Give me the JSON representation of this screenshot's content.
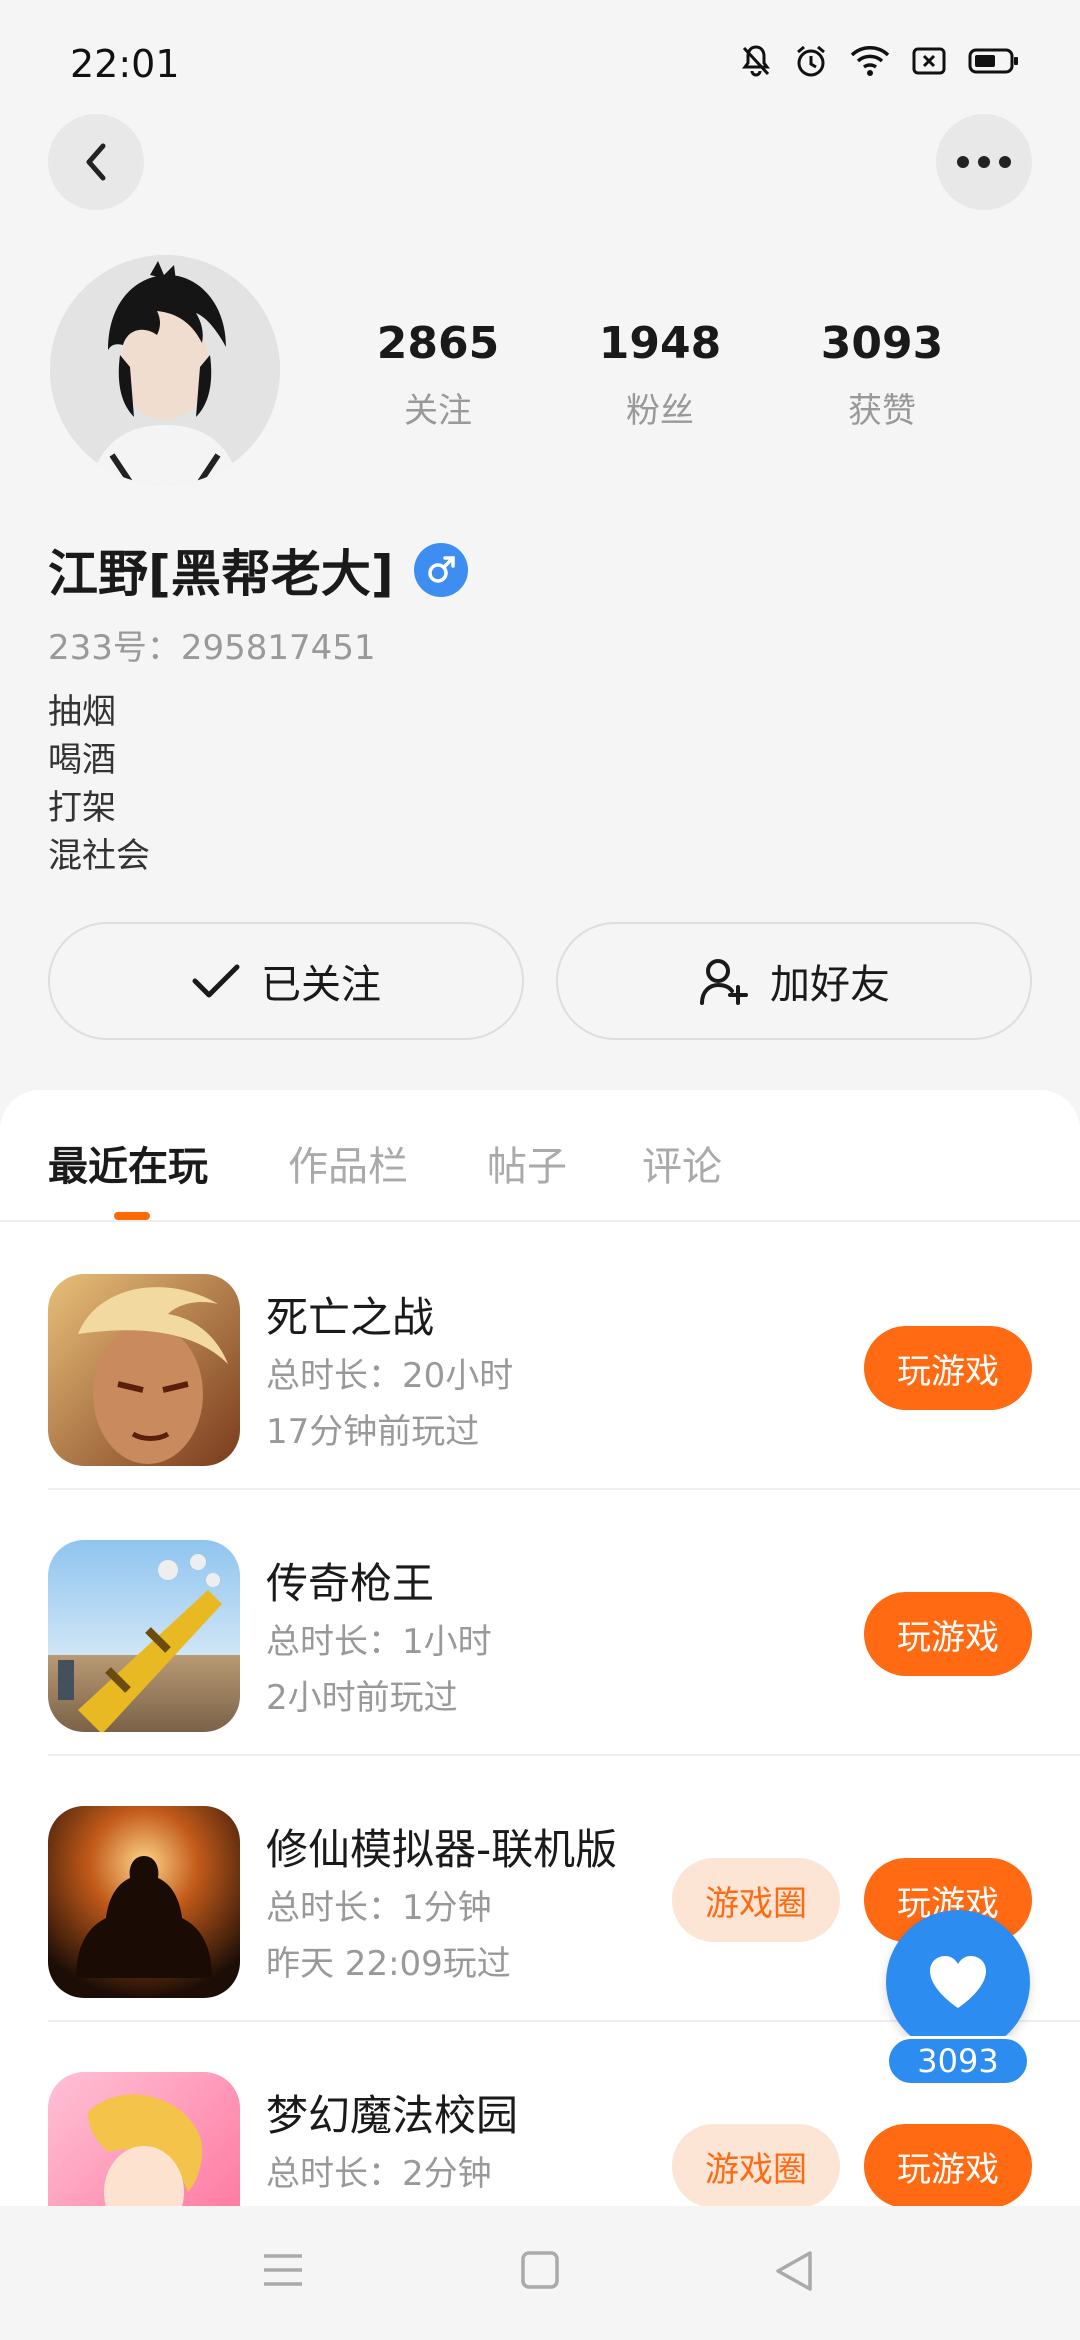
{
  "status_bar": {
    "time": "22:01"
  },
  "profile": {
    "stats": [
      {
        "value": "2865",
        "label": "关注"
      },
      {
        "value": "1948",
        "label": "粉丝"
      },
      {
        "value": "3093",
        "label": "获赞"
      }
    ],
    "username": "江野[黑帮老大]",
    "user_id": "233号：295817451",
    "bio": [
      "抽烟",
      "喝酒",
      "打架",
      "混社会"
    ],
    "follow_label": "已关注",
    "add_friend_label": "加好友"
  },
  "tabs": [
    {
      "label": "最近在玩",
      "active": true
    },
    {
      "label": "作品栏",
      "active": false
    },
    {
      "label": "帖子",
      "active": false
    },
    {
      "label": "评论",
      "active": false
    }
  ],
  "games": [
    {
      "title": "死亡之战",
      "duration": "总时长：20小时",
      "last_played": "17分钟前玩过",
      "play_label": "玩游戏",
      "circle_label": ""
    },
    {
      "title": "传奇枪王",
      "duration": "总时长：1小时",
      "last_played": "2小时前玩过",
      "play_label": "玩游戏",
      "circle_label": ""
    },
    {
      "title": "修仙模拟器-联机版",
      "duration": "总时长：1分钟",
      "last_played": "昨天 22:09玩过",
      "play_label": "玩游戏",
      "circle_label": "游戏圈"
    },
    {
      "title": "梦幻魔法校园",
      "duration": "总时长：2分钟",
      "last_played": "",
      "play_label": "玩游戏",
      "circle_label": "游戏圈"
    }
  ],
  "like_fab": {
    "count": "3093"
  },
  "colors": {
    "accent": "#ff6a12",
    "blue": "#2d8cf0",
    "tab_indicator": "#ff6a00"
  }
}
